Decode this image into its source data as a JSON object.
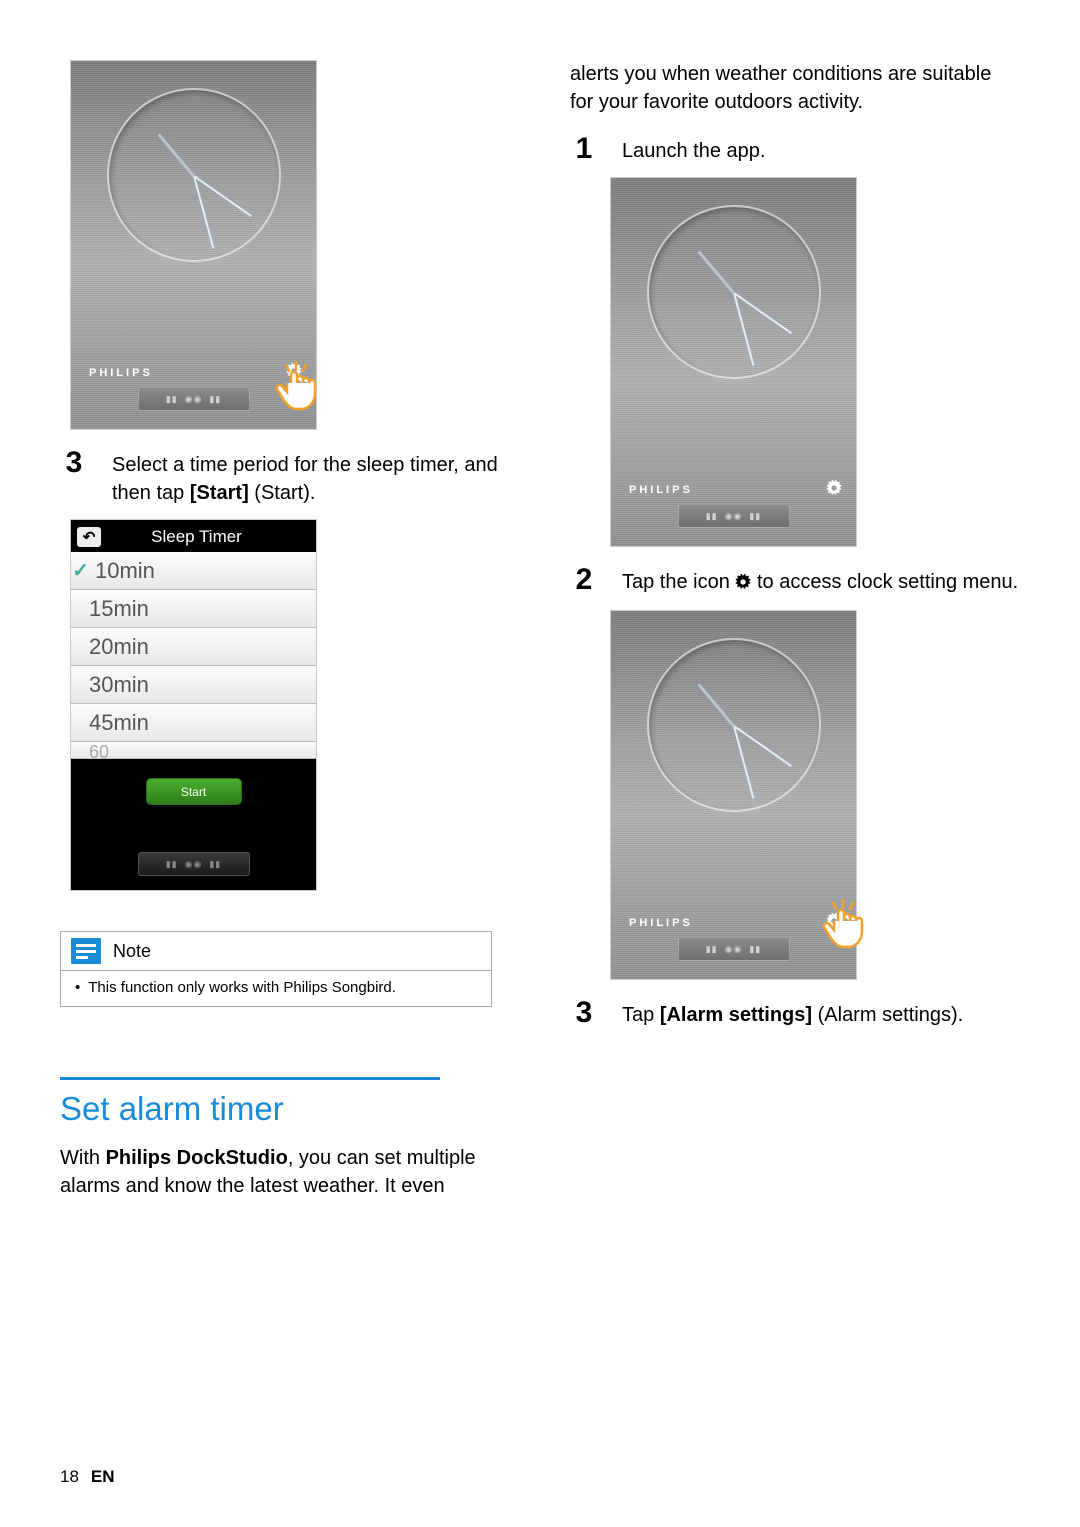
{
  "footer": {
    "page": "18",
    "lang": "EN"
  },
  "left": {
    "brand": "PHILIPS",
    "step3": {
      "num": "3",
      "text_a": "Select a time period for the sleep timer, and then tap ",
      "bold": "[Start]",
      "text_b": " (Start)."
    },
    "timer": {
      "title": "Sleep Timer",
      "options": [
        "10min",
        "15min",
        "20min",
        "30min",
        "45min"
      ],
      "cut_option": "60",
      "start_label": "Start"
    },
    "note": {
      "title": "Note",
      "body_a": "This function only works with ",
      "body_bold": "Philips Songbird",
      "body_b": "."
    },
    "section_title": "Set alarm timer",
    "section_para_a": "With ",
    "section_para_bold": "Philips DockStudio",
    "section_para_b": ", you can set multiple alarms and know the latest weather. It even "
  },
  "right": {
    "intro": "alerts you when weather conditions are suitable for your favorite outdoors activity.",
    "brand": "PHILIPS",
    "step1": {
      "num": "1",
      "text": "Launch the app."
    },
    "step2": {
      "num": "2",
      "text_a": "Tap the icon ",
      "text_b": " to access clock setting menu."
    },
    "step3": {
      "num": "3",
      "text_a": "Tap ",
      "bold": "[Alarm settings]",
      "text_b": " (Alarm settings)."
    }
  }
}
